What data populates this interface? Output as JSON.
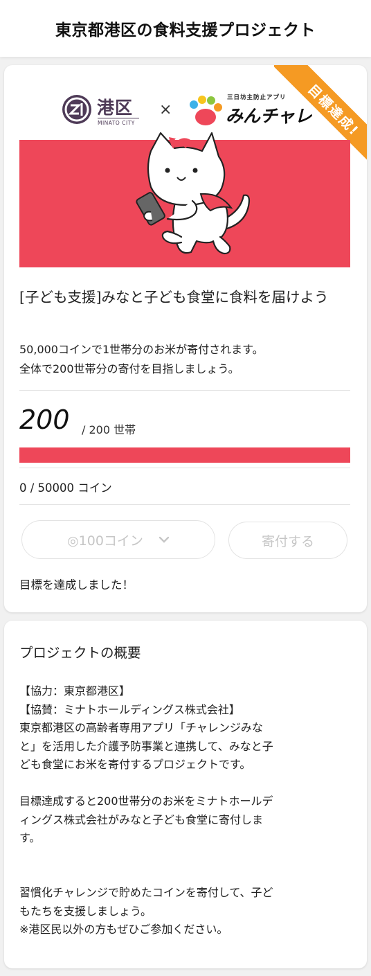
{
  "header": {
    "title": "東京都港区の食料支援プロジェクト"
  },
  "card": {
    "logos": {
      "minato_name": "港区",
      "minato_sub": "MINATO CITY",
      "cross": "×",
      "minchare_tag": "三日坊主防止アプリ",
      "minchare_name": "みんチャレ"
    },
    "ribbon": "目標達成!",
    "title": "[子ども支援]みなと子ども食堂に食料を届けよう",
    "description_lines": [
      "50,000コインで1世帯分のお米が寄付されます。",
      "全体で200世帯分の寄付を目指しましょう。"
    ],
    "progress": {
      "current": "200",
      "target_text": "/ 200 世帯",
      "fraction": 1.0
    },
    "coins_text": "0 / 50000 コイン",
    "coin_select": "◎100コイン",
    "donate_button": "寄付する",
    "status": "目標を達成しました！",
    "colors": {
      "accent": "#ee4759",
      "ribbon": "#f59a23",
      "minato": "#4e3a57"
    }
  },
  "overview": {
    "title": "プロジェクトの概要",
    "lines_a": [
      "【協力：東京都港区】",
      "【協賛：ミナトホールディングス株式会社】",
      "東京都港区の高齢者専用アプリ「チャレンジみな",
      "と」を活用した介護予防事業と連携して、みなと子",
      "ども食堂にお米を寄付するプロジェクトです。"
    ],
    "lines_b": [
      "目標達成すると200世帯分のお米をミナトホールデ",
      "ィングス株式会社がみなと子ども食堂に寄付しま",
      "す。"
    ],
    "lines_c": [
      "習慣化チャレンジで貯めたコインを寄付して、子ど",
      "もたちを支援しましょう。",
      "※港区民以外の方もぜひご参加ください。"
    ]
  }
}
